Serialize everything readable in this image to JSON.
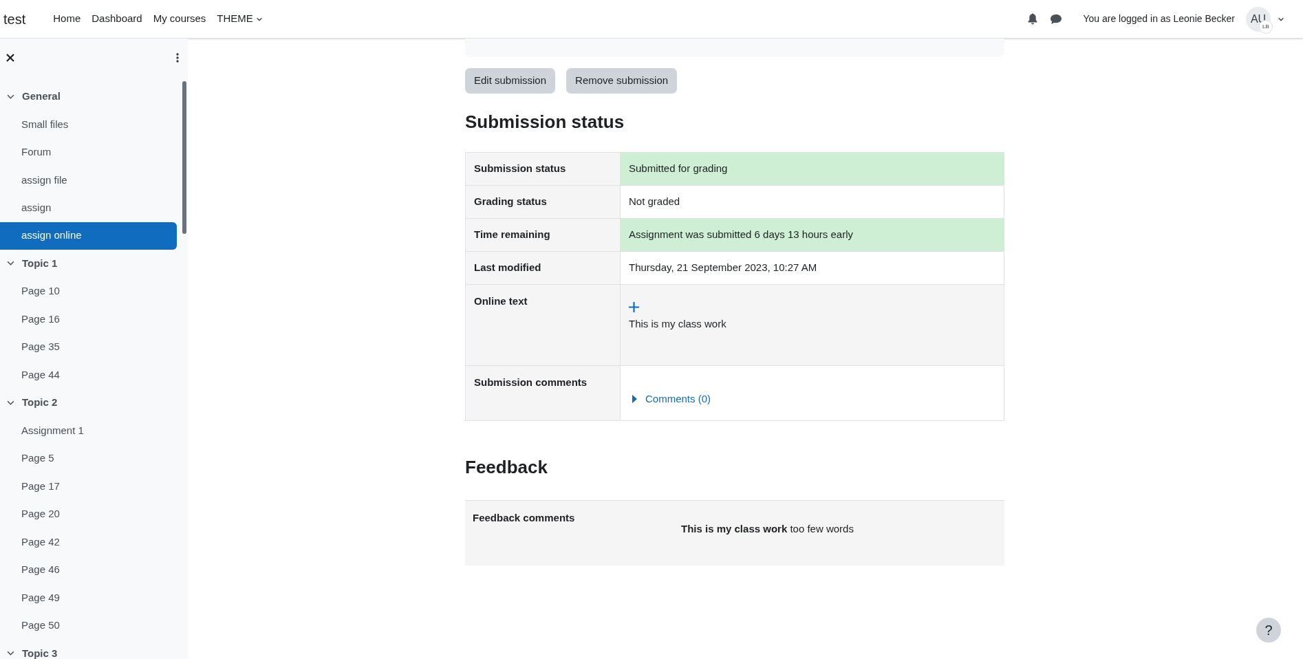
{
  "navbar": {
    "brand": "test",
    "links": [
      {
        "label": "Home",
        "dropdown": false
      },
      {
        "label": "Dashboard",
        "dropdown": false
      },
      {
        "label": "My courses",
        "dropdown": false
      },
      {
        "label": "THEME",
        "dropdown": true
      }
    ],
    "login_text": "You are logged in as Leonie Becker",
    "avatar": {
      "initials": "AU",
      "badge": "LB"
    }
  },
  "sidebar": {
    "sections": [
      {
        "title": "General",
        "expanded": true,
        "items": [
          {
            "label": "Small files",
            "selected": false
          },
          {
            "label": "Forum",
            "selected": false
          },
          {
            "label": "assign file",
            "selected": false
          },
          {
            "label": "assign",
            "selected": false
          },
          {
            "label": "assign online",
            "selected": true
          }
        ]
      },
      {
        "title": "Topic 1",
        "expanded": true,
        "items": [
          {
            "label": "Page 10",
            "selected": false
          },
          {
            "label": "Page 16",
            "selected": false
          },
          {
            "label": "Page 35",
            "selected": false
          },
          {
            "label": "Page 44",
            "selected": false
          }
        ]
      },
      {
        "title": "Topic 2",
        "expanded": true,
        "items": [
          {
            "label": "Assignment 1",
            "selected": false
          },
          {
            "label": "Page 5",
            "selected": false
          },
          {
            "label": "Page 17",
            "selected": false
          },
          {
            "label": "Page 20",
            "selected": false
          },
          {
            "label": "Page 42",
            "selected": false
          },
          {
            "label": "Page 46",
            "selected": false
          },
          {
            "label": "Page 49",
            "selected": false
          },
          {
            "label": "Page 50",
            "selected": false
          }
        ]
      },
      {
        "title": "Topic 3",
        "expanded": true
      }
    ]
  },
  "actions": [
    "Edit submission",
    "Remove submission"
  ],
  "submission_status": {
    "heading": "Submission status",
    "rows": [
      {
        "kind": "text",
        "label": "Submission status",
        "value": "Submitted for grading",
        "highlight": true
      },
      {
        "kind": "text",
        "label": "Grading status",
        "value": "Not graded",
        "highlight": false
      },
      {
        "kind": "text",
        "label": "Time remaining",
        "value": "Assignment was submitted 6 days 13 hours early",
        "highlight": true
      },
      {
        "kind": "text",
        "label": "Last modified",
        "value": "Thursday, 21 September 2023, 10:27 AM",
        "highlight": false
      },
      {
        "kind": "online",
        "label": "Online text",
        "value": "This is my class work"
      },
      {
        "kind": "comments",
        "label": "Submission comments",
        "value": "Comments (0)"
      }
    ]
  },
  "feedback": {
    "heading": "Feedback",
    "label": "Feedback comments",
    "value": "**This is my class work** too few words"
  },
  "help_button": "?"
}
